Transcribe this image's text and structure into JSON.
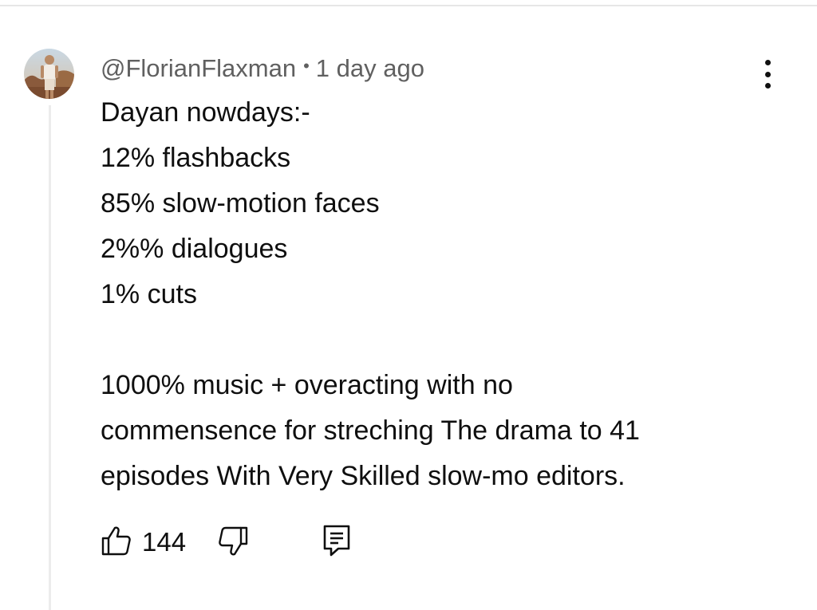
{
  "comment": {
    "author": "@FlorianFlaxman",
    "separator": "•",
    "timestamp": "1 day ago",
    "lines": [
      "Dayan nowdays:-",
      "12% flashbacks",
      "85% slow-motion faces",
      "2%% dialogues",
      "1% cuts"
    ],
    "paragraph_lines": [
      "1000% music + overacting with no",
      "commensence for streching The drama to 41",
      "episodes With Very Skilled slow-mo editors."
    ],
    "like_count": "144"
  },
  "icons": {
    "avatar": "avatar-photo",
    "more": "more-vertical-icon",
    "like": "thumbs-up-icon",
    "dislike": "thumbs-down-icon",
    "reply": "reply-comment-icon"
  },
  "colors": {
    "text": "#0f0f0f",
    "meta": "#606060",
    "thread_line": "#ececec"
  }
}
